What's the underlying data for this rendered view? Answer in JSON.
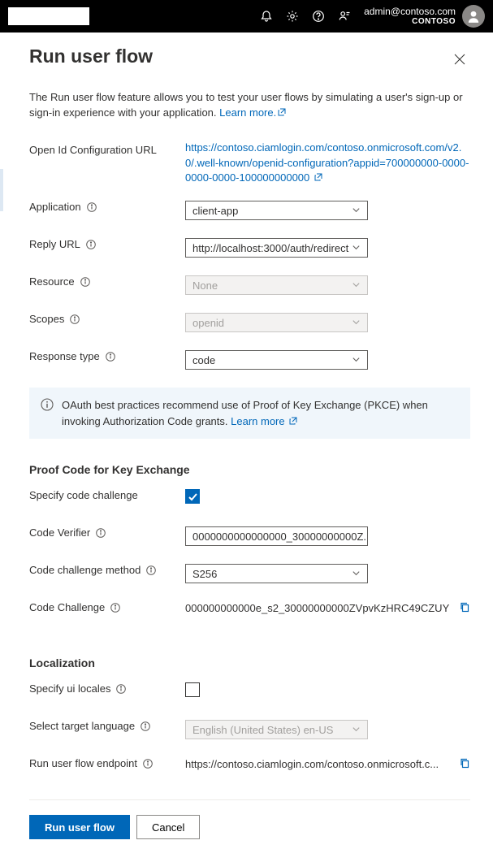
{
  "topbar": {
    "user_email": "admin@contoso.com",
    "org": "CONTOSO"
  },
  "panel": {
    "title": "Run user flow",
    "intro_text": "The Run user flow feature allows you to test your user flows by simulating a user's sign-up or sign-in experience with your application. ",
    "learn_more": "Learn more."
  },
  "fields": {
    "openid_label": "Open Id Configuration URL",
    "openid_url": "https://contoso.ciamlogin.com/contoso.onmicrosoft.com/v2.0/.well-known/openid-configuration?appid=700000000-0000-0000-0000-100000000000",
    "application_label": "Application",
    "application_value": "client-app",
    "reply_url_label": "Reply URL",
    "reply_url_value": "http://localhost:3000/auth/redirect",
    "resource_label": "Resource",
    "resource_value": "None",
    "scopes_label": "Scopes",
    "scopes_value": "openid",
    "response_type_label": "Response type",
    "response_type_value": "code"
  },
  "info_banner": {
    "text": "OAuth best practices recommend use of Proof of Key Exchange (PKCE) when invoking Authorization Code grants. ",
    "learn_more": "Learn more"
  },
  "pkce": {
    "section_title": "Proof Code for Key Exchange",
    "specify_label": "Specify code challenge",
    "specify_checked": true,
    "verifier_label": "Code Verifier",
    "verifier_value": "0000000000000000_30000000000Z...",
    "method_label": "Code challenge method",
    "method_value": "S256",
    "challenge_label": "Code Challenge",
    "challenge_value": "000000000000e_s2_30000000000ZVpvKzHRC49CZUY"
  },
  "localization": {
    "section_title": "Localization",
    "specify_label": "Specify ui locales",
    "specify_checked": false,
    "lang_label": "Select target language",
    "lang_value": "English (United States) en-US"
  },
  "endpoint": {
    "label": "Run user flow endpoint",
    "value": "https://contoso.ciamlogin.com/contoso.onmicrosoft.c..."
  },
  "buttons": {
    "run": "Run user flow",
    "cancel": "Cancel"
  }
}
